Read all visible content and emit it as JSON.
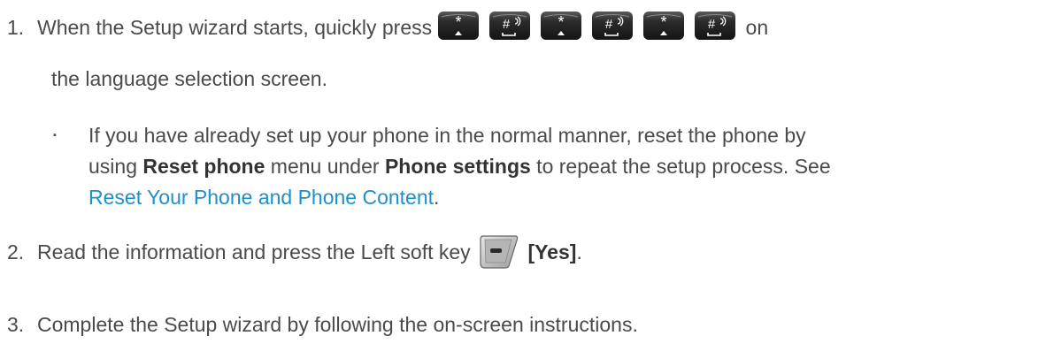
{
  "steps": [
    {
      "num": "1.",
      "before_keys": "When the Setup wizard starts, quickly press",
      "after_keys": " on",
      "line2": "the language selection screen.",
      "keys": [
        "star-key-icon",
        "pound-key-icon",
        "star-key-icon",
        "pound-key-icon",
        "star-key-icon",
        "pound-key-icon"
      ]
    },
    {
      "num": "2.",
      "before_icon": "Read the information and press the Left soft key ",
      "bold_after": "[Yes]",
      "tail": "."
    },
    {
      "num": "3.",
      "text": "Complete the Setup wizard by following the on-screen instructions."
    }
  ],
  "note": {
    "bullet": "▪",
    "t1": "If you have already set up your phone in the normal manner, reset the phone by",
    "t2": "using ",
    "b1": "Reset phone",
    "t3": " menu under ",
    "b2": "Phone settings",
    "t4": " to repeat the setup process. See",
    "link": "Reset Your Phone and Phone Content",
    "t5": "."
  },
  "colors": {
    "text": "#4a4a4a",
    "link": "#1f8fc9",
    "key_dark": "#2a2a2a"
  }
}
